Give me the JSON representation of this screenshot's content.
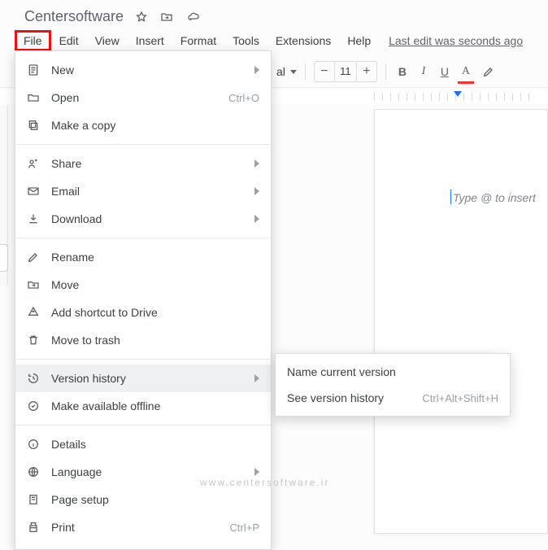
{
  "doc": {
    "title": "Centersoftware"
  },
  "menubar": {
    "file": "File",
    "edit": "Edit",
    "view": "View",
    "insert": "Insert",
    "format": "Format",
    "tools": "Tools",
    "extensions": "Extensions",
    "help": "Help",
    "last_edit": "Last edit was seconds ago"
  },
  "toolbar": {
    "style_label": "al",
    "font_size": "11",
    "bold": "B",
    "italic": "I",
    "underline": "U",
    "colorA": "A"
  },
  "page": {
    "hint": "Type @ to insert"
  },
  "file_menu": {
    "new": "New",
    "open": "Open",
    "open_shortcut": "Ctrl+O",
    "make_copy": "Make a copy",
    "share": "Share",
    "email": "Email",
    "download": "Download",
    "rename": "Rename",
    "move": "Move",
    "add_shortcut": "Add shortcut to Drive",
    "move_trash": "Move to trash",
    "version_history": "Version history",
    "offline": "Make available offline",
    "details": "Details",
    "language": "Language",
    "page_setup": "Page setup",
    "print": "Print",
    "print_shortcut": "Ctrl+P"
  },
  "version_submenu": {
    "name_current": "Name current version",
    "see_history": "See version history",
    "see_history_shortcut": "Ctrl+Alt+Shift+H"
  },
  "watermark": "www.centersoftware.ir"
}
